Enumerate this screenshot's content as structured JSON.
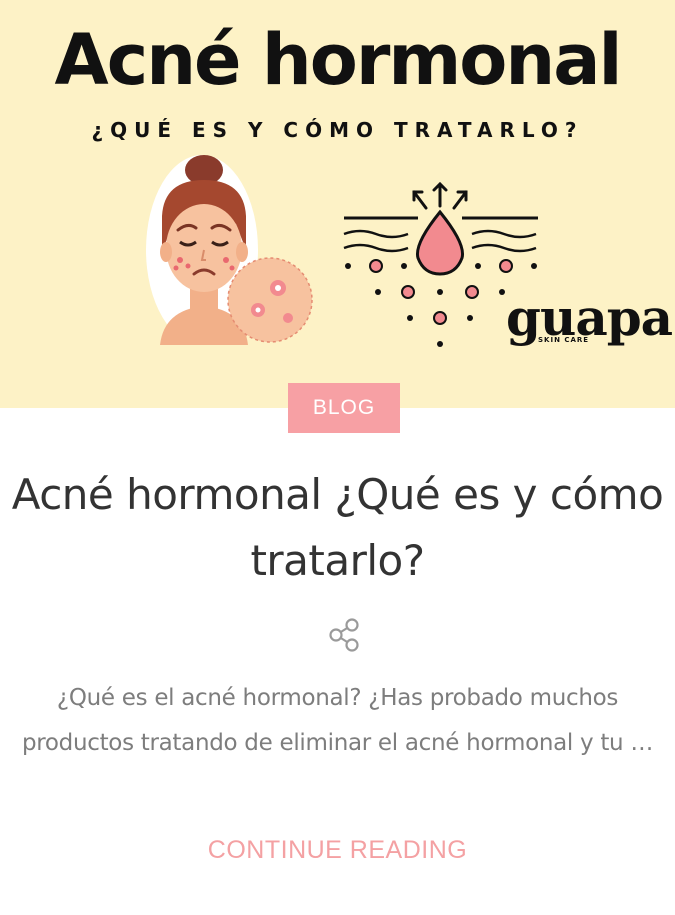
{
  "hero": {
    "title": "Acné hormonal",
    "subtitle": "¿QUÉ ES Y CÓMO TRATARLO?",
    "brand": "guapa",
    "brand_sub": "SKIN CARE",
    "background_color": "#fdf2c6"
  },
  "post": {
    "category": "BLOG",
    "title": "Acné hormonal ¿Qué es y cómo tratarlo?",
    "excerpt": "¿Qué es el acné hormonal? ¿Has probado muchos productos tratando de eliminar el acné hormonal y tu …",
    "continue_label": "CONTINUE READING",
    "share_icon": "share-icon"
  },
  "colors": {
    "accent": "#f7a0a4",
    "title_text": "#333333",
    "excerpt_text": "#7d7d7d"
  }
}
